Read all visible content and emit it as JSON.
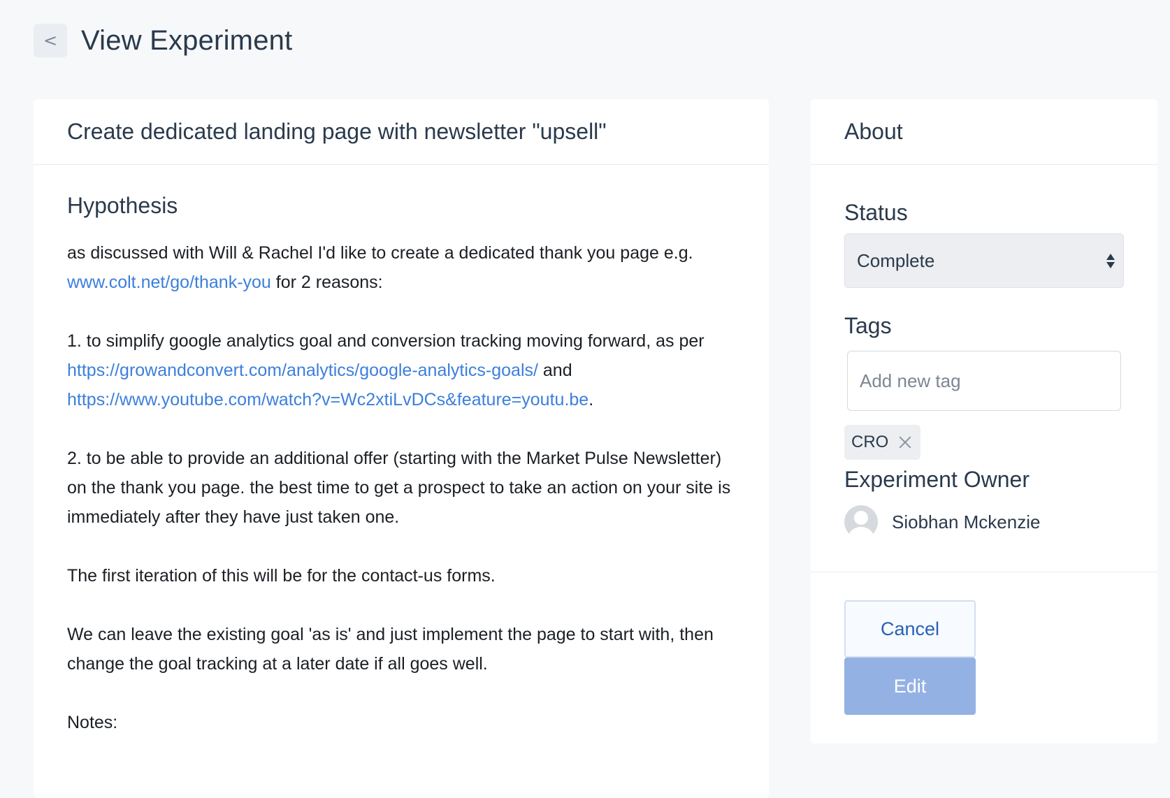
{
  "header": {
    "back_glyph": "<",
    "title": "View Experiment"
  },
  "experiment": {
    "title": "Create dedicated landing page with newsletter \"upsell\"",
    "hypothesis_heading": "Hypothesis",
    "paragraphs": {
      "p1_text1": "as discussed with Will & Rachel I'd like to create a dedicated thank you page e.g. ",
      "p1_link": "www.colt.net/go/thank-you",
      "p1_text2": " for 2 reasons:",
      "p2_text1": "1. to simplify google analytics goal and conversion tracking moving forward, as per ",
      "p2_link1": "https://growandconvert.com/analytics/google-analytics-goals/",
      "p2_text2": " and ",
      "p2_link2": "https://www.youtube.com/watch?v=Wc2xtiLvDCs&feature=youtu.be",
      "p2_text3": ".",
      "p3": "2. to be able to provide an additional offer (starting with the Market Pulse Newsletter) on the thank you page. the best time to get a prospect to take an action on your site is immediately after they have just taken one.",
      "p4": "The first iteration of this will be for the contact-us forms.",
      "p5": "We can leave the existing goal 'as is' and just implement the page to start with, then change the goal tracking at a later date if all goes well.",
      "p6": "Notes:"
    }
  },
  "about": {
    "title": "About",
    "status_label": "Status",
    "status_value": "Complete",
    "tags_label": "Tags",
    "tag_placeholder": "Add new tag",
    "tags": [
      "CRO"
    ],
    "owner_label": "Experiment Owner",
    "owner_name": "Siobhan Mckenzie",
    "cancel_label": "Cancel",
    "edit_label": "Edit"
  },
  "colors": {
    "background": "#f6f8fa",
    "link": "#3c7fdc",
    "edit_button": "#94b1e4",
    "cancel_text": "#2860b8"
  },
  "icons": {
    "back": "chevron-left-icon",
    "select": "select-arrows-icon",
    "tag_remove": "close-icon",
    "avatar": "user-avatar-icon"
  }
}
